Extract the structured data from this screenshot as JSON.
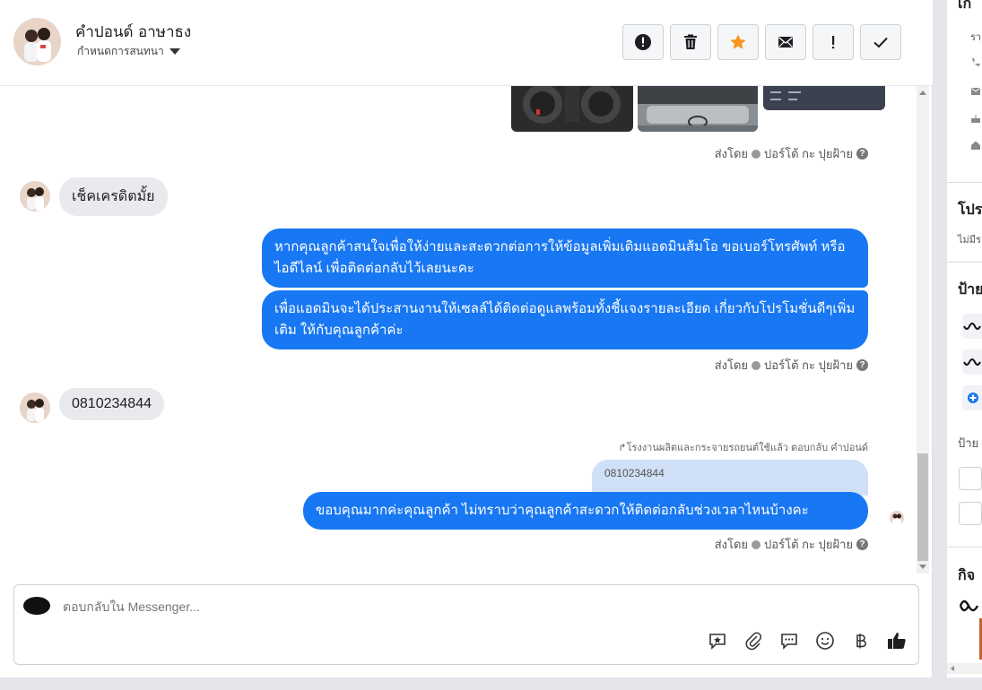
{
  "header": {
    "name": "คำปอนด์ อาษาธง",
    "subtitle": "กำหนดการสนทนา",
    "buttons": [
      "report",
      "delete",
      "star",
      "mail",
      "important",
      "done"
    ]
  },
  "messages": {
    "sent_by_label": "ส่งโดย",
    "sender": "ปอร์โต้ กะ ปุยฝ้าย",
    "incoming_1": "เช็คเครดิตมั้ย",
    "outgoing_1": "หากคุณลูกค้าสนใจเพื่อให้ง่ายและสะดวกต่อการให้ข้อมูลเพิ่มเติมแอดมินส้มโอ ขอเบอร์โทรศัพท์ หรือ ไอดีไลน์ เพื่อติดต่อกลับไว้เลยนะคะ",
    "outgoing_2": "เพื่อแอดมินจะได้ประสานงานให้เซลล์ได้ติดต่อดูแลพร้อมทั้งชี้แจงรายละเอียด เกี่ยวกับโปรโมชั่นดีๆเพิ่มเติม ให้กับคุณลูกค้าค่ะ",
    "incoming_2": "0810234844",
    "reply_note": "โรงงานผลิตและกระจายรถยนต์ใช้แล้ว ตอบกลับ คำปอนด์",
    "quoted": "0810234844",
    "outgoing_3": "ขอบคุณมากค่ะคุณลูกค้า ไม่ทราบว่าคุณลูกค้าสะดวกให้ติดต่อกลับช่วงเวลาไหนบ้างคะ"
  },
  "composer": {
    "placeholder": "ตอบกลับใน Messenger..."
  },
  "right_panel": {
    "top_label": "เกี่",
    "row_label": "รา",
    "section_1": "โปร",
    "section_1_sub": "ไม่มีร",
    "section_2": "ป้าย",
    "section_2_sub": "ป้าย",
    "section_3": "กิจ"
  },
  "colors": {
    "accent": "#1877f2",
    "incoming_bubble": "#e9eaed",
    "star": "#f7931e"
  }
}
